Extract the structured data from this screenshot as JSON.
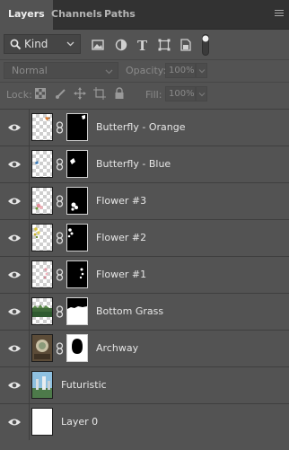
{
  "tabs": [
    {
      "label": "Layers"
    },
    {
      "label": "Channels"
    },
    {
      "label": "Paths"
    }
  ],
  "filter": {
    "kind_label": "Kind"
  },
  "blend": {
    "mode": "Normal",
    "opacity_label": "Opacity:",
    "opacity_value": "100%"
  },
  "locks": {
    "label": "Lock:",
    "fill_label": "Fill:",
    "fill_value": "100%"
  },
  "layers": [
    {
      "name": "Butterfly - Orange"
    },
    {
      "name": "Butterfly - Blue"
    },
    {
      "name": "Flower #3"
    },
    {
      "name": "Flower #2"
    },
    {
      "name": "Flower #1"
    },
    {
      "name": "Bottom Grass"
    },
    {
      "name": "Archway"
    },
    {
      "name": "Futuristic"
    },
    {
      "name": "Layer 0"
    }
  ]
}
